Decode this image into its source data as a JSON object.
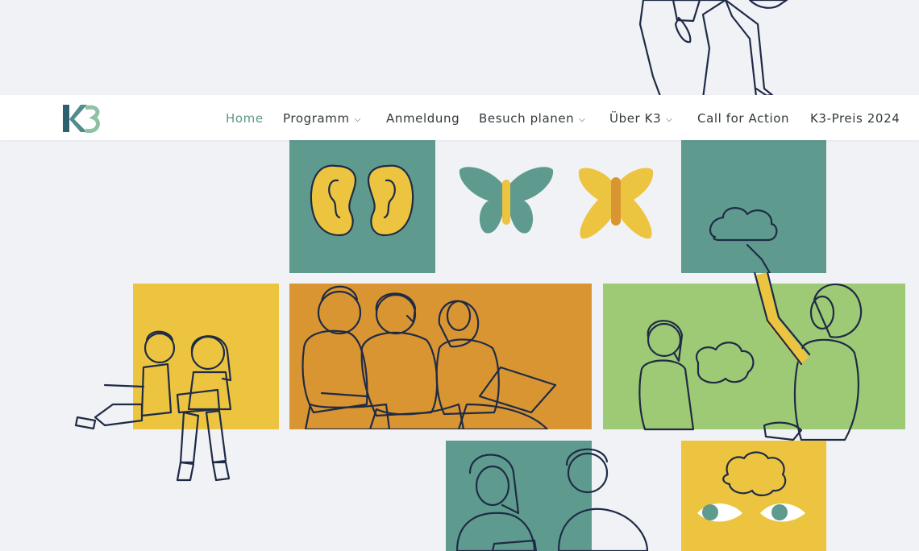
{
  "header": {
    "logo_alt": "K3",
    "nav": [
      {
        "label": "Home",
        "active": true,
        "has_dropdown": false
      },
      {
        "label": "Programm",
        "active": false,
        "has_dropdown": true
      },
      {
        "label": "Anmeldung",
        "active": false,
        "has_dropdown": false
      },
      {
        "label": "Besuch planen",
        "active": false,
        "has_dropdown": true
      },
      {
        "label": "Über K3",
        "active": false,
        "has_dropdown": true
      },
      {
        "label": "Call for Action",
        "active": false,
        "has_dropdown": false
      },
      {
        "label": "K3-Preis 2024",
        "active": false,
        "has_dropdown": false
      }
    ]
  },
  "colors": {
    "background": "#f1f2f6",
    "teal": "#5e9b8e",
    "yellow": "#ecc440",
    "orange": "#d99532",
    "green": "#9ec975",
    "ink": "#1f2b46",
    "active_nav": "#5a9a86"
  },
  "illustrations": [
    {
      "name": "leaning-person"
    },
    {
      "name": "ears"
    },
    {
      "name": "teal-butterfly"
    },
    {
      "name": "yellow-butterfly"
    },
    {
      "name": "person-reaching-cloud"
    },
    {
      "name": "children-reading"
    },
    {
      "name": "group-with-laptop"
    },
    {
      "name": "child-holding-cloud"
    },
    {
      "name": "two-people-with-paper"
    },
    {
      "name": "brain-and-eyes"
    }
  ]
}
